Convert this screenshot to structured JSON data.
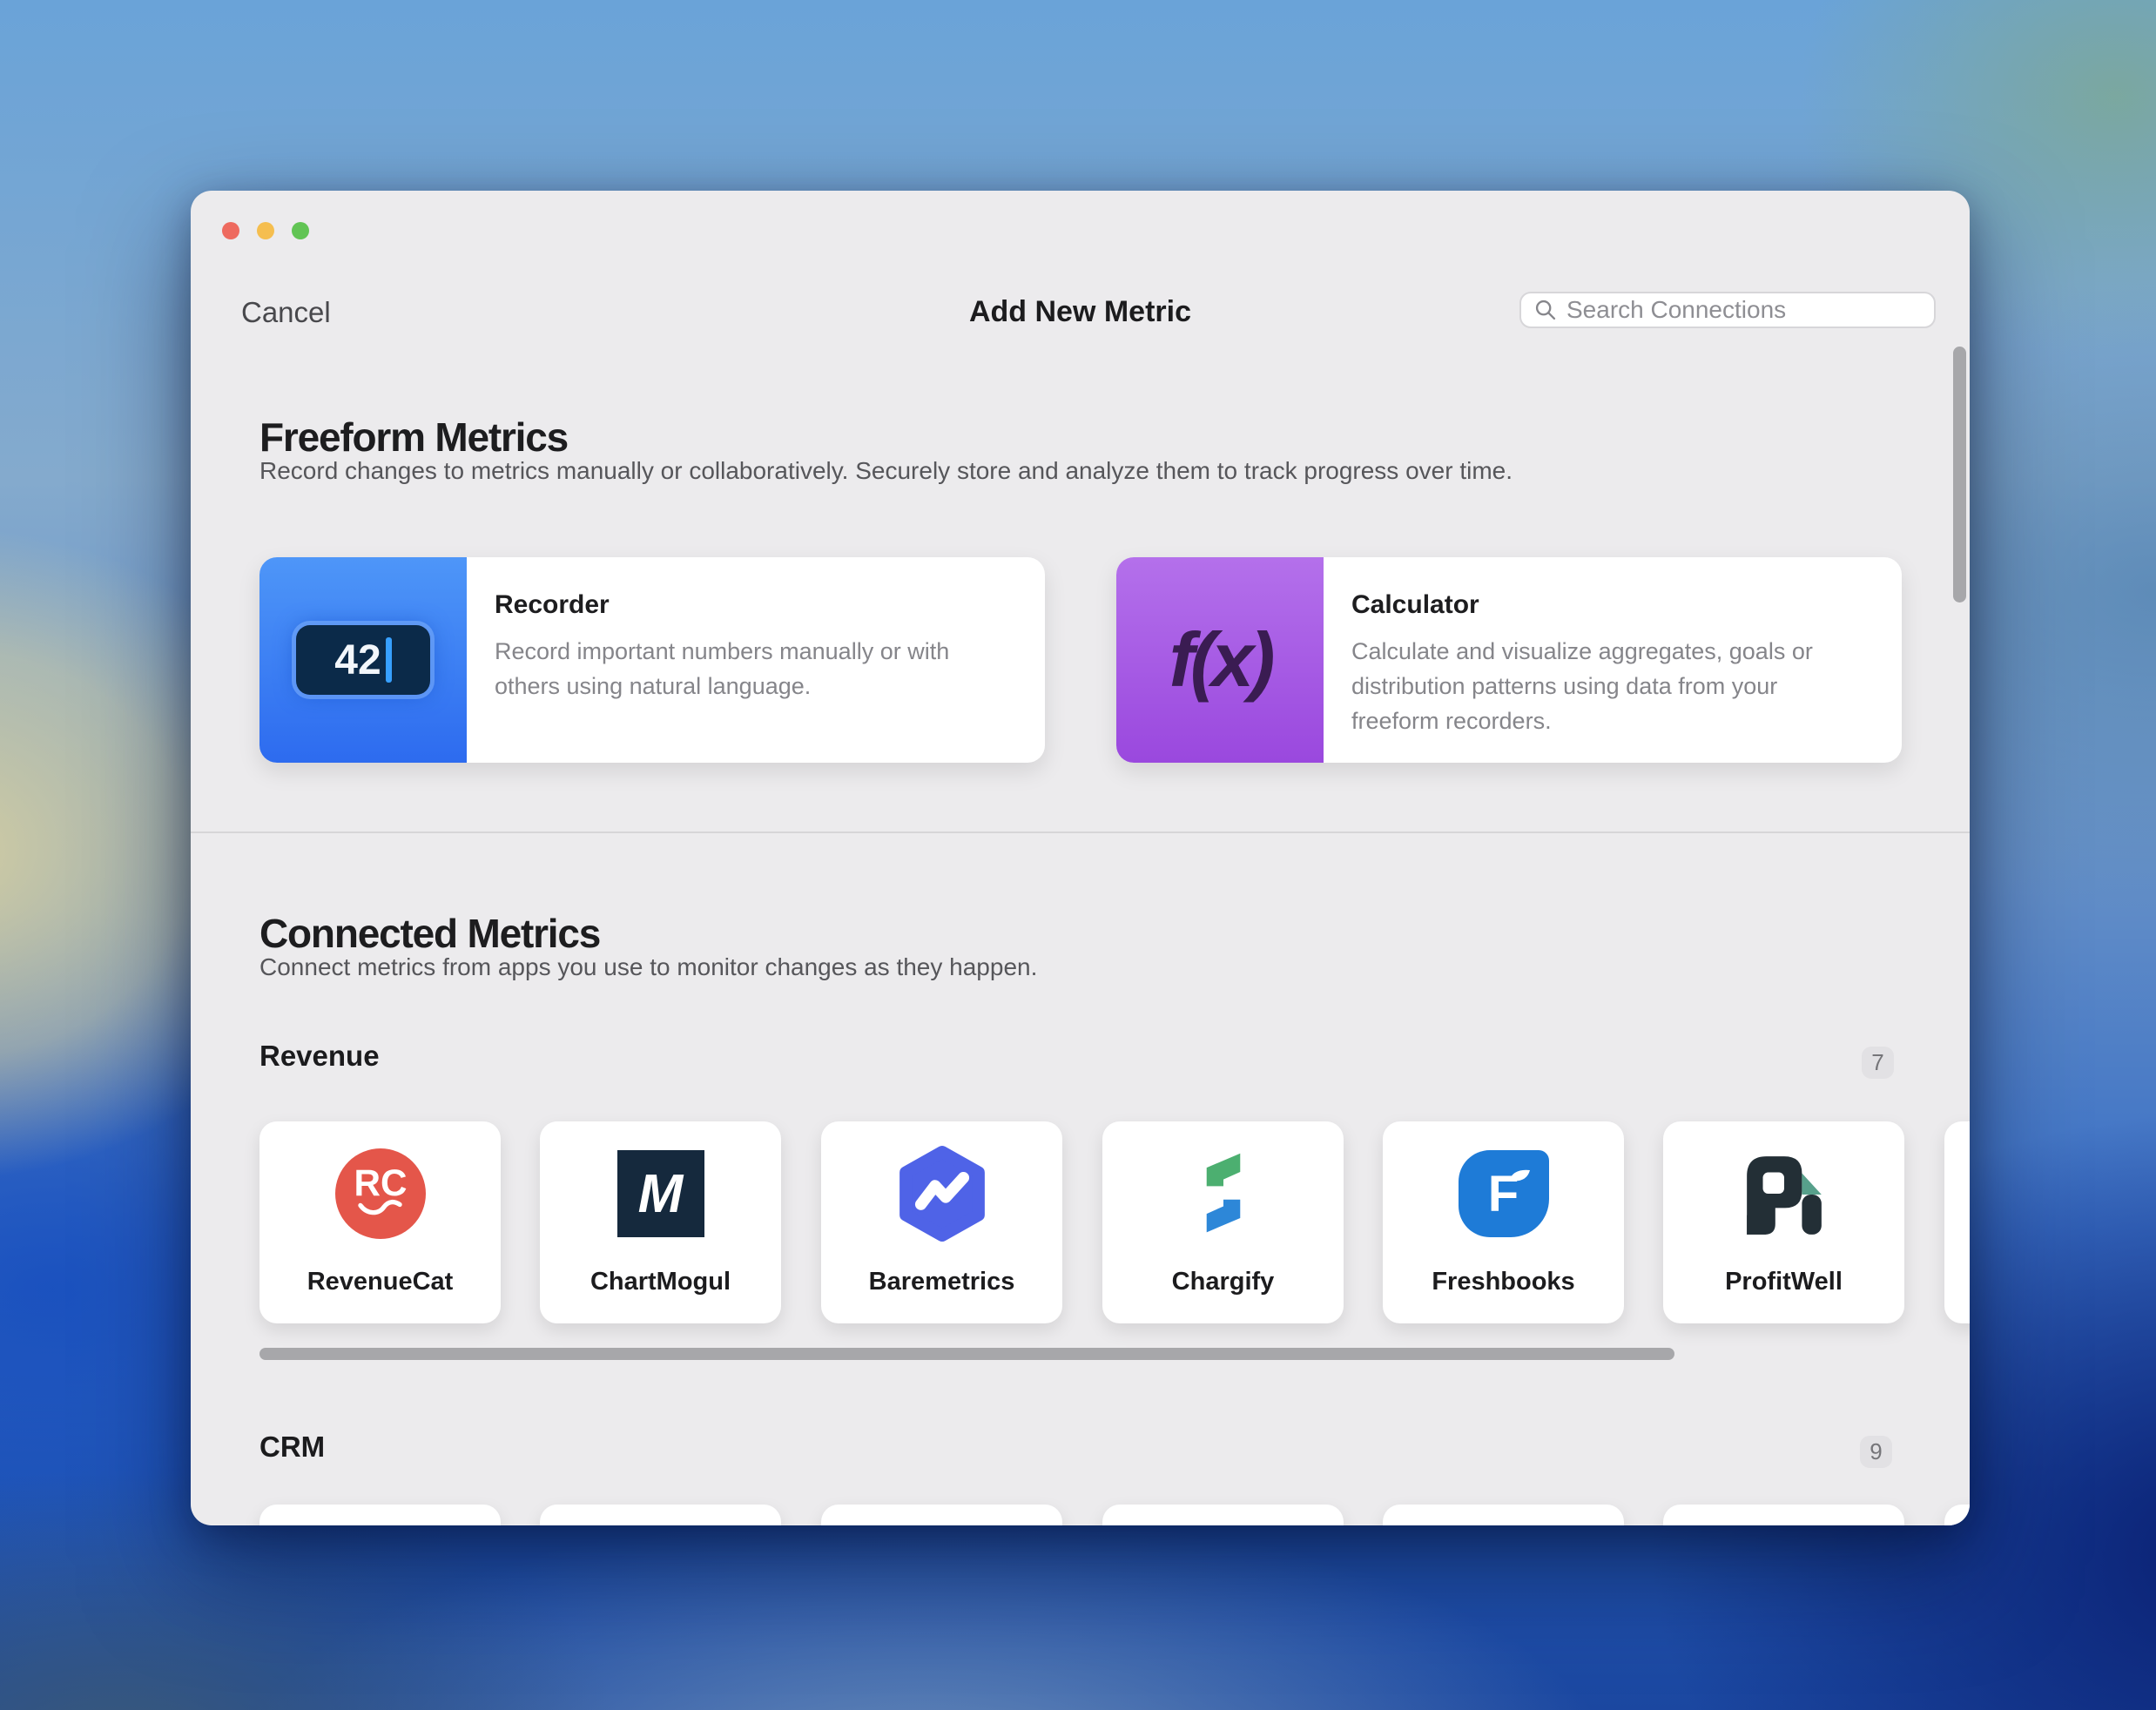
{
  "titlebar": {
    "cancel": "Cancel",
    "title": "Add New Metric",
    "search_placeholder": "Search Connections"
  },
  "freeform": {
    "heading": "Freeform Metrics",
    "subheading": "Record changes to metrics manually or collaboratively. Securely store and analyze them to track progress over time.",
    "cards": [
      {
        "title": "Recorder",
        "description": "Record important numbers manually or with others using natural language.",
        "icon": "recorder-input-tile",
        "icon_text": "42",
        "gradient_top": "#4E96F8",
        "gradient_bottom": "#2D6BEF"
      },
      {
        "title": "Calculator",
        "description": "Calculate and visualize aggregates, goals or distribution patterns using data from your freeform recorders.",
        "icon": "function-fx-glyph",
        "icon_text": "f(x)",
        "gradient_top": "#B470EB",
        "gradient_bottom": "#9A48DE"
      }
    ]
  },
  "connected": {
    "heading": "Connected Metrics",
    "subheading": "Connect metrics from apps you use to monitor changes as they happen.",
    "categories": [
      {
        "name": "Revenue",
        "count": "7",
        "apps": [
          {
            "name": "RevenueCat",
            "icon": "revenuecat-icon",
            "color": "#E4564A"
          },
          {
            "name": "ChartMogul",
            "icon": "chartmogul-icon",
            "color": "#15293D"
          },
          {
            "name": "Baremetrics",
            "icon": "baremetrics-icon",
            "color": "#4F63E7"
          },
          {
            "name": "Chargify",
            "icon": "chargify-icon",
            "color": "#4CAF70"
          },
          {
            "name": "Freshbooks",
            "icon": "freshbooks-icon",
            "color": "#1E7BD7"
          },
          {
            "name": "ProfitWell",
            "icon": "profitwell-icon",
            "color": "#232F36"
          }
        ]
      },
      {
        "name": "CRM",
        "count": "9",
        "apps": []
      }
    ]
  }
}
